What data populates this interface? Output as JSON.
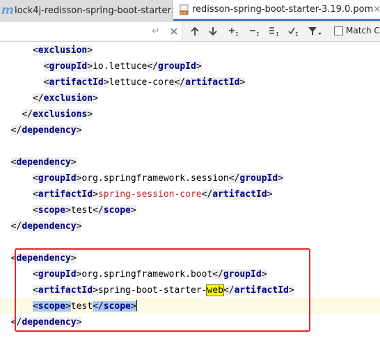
{
  "tabs": [
    {
      "label": "lock4j-redisson-spring-boot-starter",
      "icon": "maven-module-icon",
      "icon_glyph": "m",
      "active": false
    },
    {
      "label": "redisson-spring-boot-starter-3.19.0.pom",
      "icon": "pom-file-icon",
      "active": true
    }
  ],
  "tab_close_glyph": "×",
  "search": {
    "value": "",
    "enter_glyph": "↵",
    "match_case_label": "Match Ca"
  },
  "colors": {
    "tag": "#000080",
    "string_red": "#c0262a",
    "caret_line": "#fcfae3",
    "highlight_box": "#e8262a",
    "search_match": "#ffff00",
    "selection": "#a9c9f5",
    "active_tab_underline": "#4a78c8"
  },
  "code": {
    "l0": {
      "pre": "      ",
      "open": "exclusion"
    },
    "l1": {
      "pre": "        ",
      "open": "groupId",
      "text": "io.lettuce",
      "close": "groupId"
    },
    "l2": {
      "pre": "        ",
      "open": "artifactId",
      "text": "lettuce-core",
      "close": "artifactId"
    },
    "l3": {
      "pre": "      ",
      "close": "exclusion"
    },
    "l4": {
      "pre": "    ",
      "close": "exclusions"
    },
    "l5": {
      "pre": "  ",
      "close": "dependency"
    },
    "l7": {
      "pre": "  ",
      "open": "dependency"
    },
    "l8": {
      "pre": "      ",
      "open": "groupId",
      "text": "org.springframework.session",
      "close": "groupId"
    },
    "l9": {
      "pre": "      ",
      "open": "artifactId",
      "text": "spring-session-core",
      "close": "artifactId"
    },
    "l10": {
      "pre": "      ",
      "open": "scope",
      "text": "test",
      "close": "scope"
    },
    "l11": {
      "pre": "  ",
      "close": "dependency"
    },
    "l13": {
      "pre": "  ",
      "open": "dependency"
    },
    "l14": {
      "pre": "      ",
      "open": "groupId",
      "text": "org.springframework.boot",
      "close": "groupId"
    },
    "l15": {
      "pre": "      ",
      "open": "artifactId",
      "text_before": "spring-boot-starter-",
      "match": "web",
      "close": "artifactId"
    },
    "l16": {
      "pre": "      ",
      "open": "scope",
      "text": "test",
      "close": "scope"
    },
    "l17": {
      "pre": "  ",
      "close": "dependency"
    }
  }
}
